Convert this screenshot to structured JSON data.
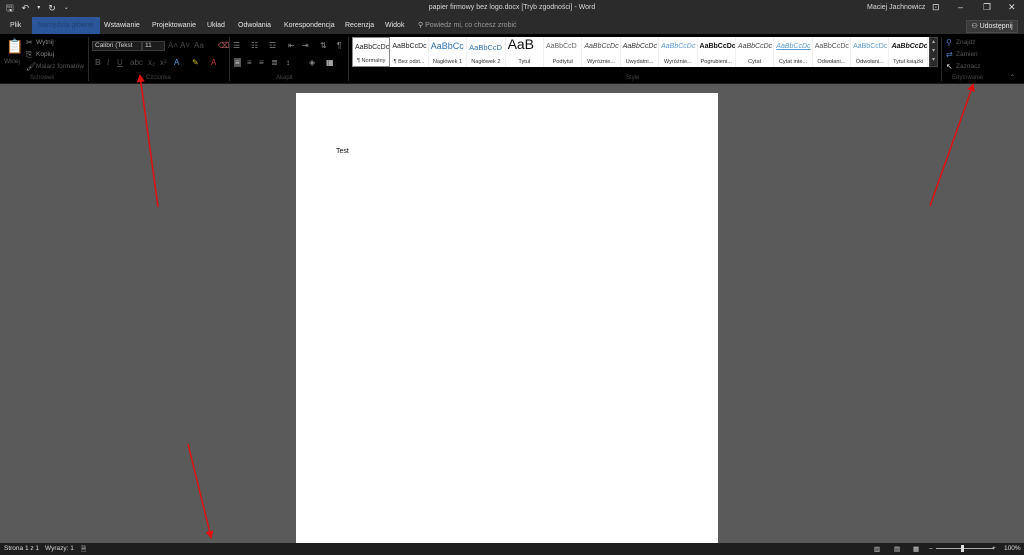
{
  "titlebar": {
    "doc_title": "papier firmowy bez logo.docx [Tryb zgodności] - Word",
    "user": "Maciej Jachnowicz"
  },
  "tabs": [
    {
      "label": "Plik"
    },
    {
      "label": "Narzędzia główne"
    },
    {
      "label": "Wstawianie"
    },
    {
      "label": "Projektowanie"
    },
    {
      "label": "Układ"
    },
    {
      "label": "Odwołania"
    },
    {
      "label": "Korespondencja"
    },
    {
      "label": "Recenzja"
    },
    {
      "label": "Widok"
    }
  ],
  "tell_me": "Powiedz mi, co chcesz zrobić",
  "share": "Udostępnij",
  "clipboard": {
    "paste": "Wklej",
    "cut": "Wytnij",
    "copy": "Kopiuj",
    "format_painter": "Malarz formatów",
    "group": "Schowek"
  },
  "font": {
    "name": "Calibri (Tekst",
    "size": "11",
    "group": "Czcionka"
  },
  "paragraph": {
    "group": "Akapit"
  },
  "styles": {
    "group": "Style",
    "items": [
      {
        "preview": "AaBbCcDc",
        "name": "¶ Normalny"
      },
      {
        "preview": "AaBbCcDc",
        "name": "¶ Bez odst..."
      },
      {
        "preview": "AaBbCc",
        "name": "Nagłówek 1"
      },
      {
        "preview": "AaBbCcD",
        "name": "Nagłówek 2"
      },
      {
        "preview": "AaB",
        "name": "Tytuł"
      },
      {
        "preview": "AaBbCcD",
        "name": "Podtytuł"
      },
      {
        "preview": "AaBbCcDc",
        "name": "Wyróżnie..."
      },
      {
        "preview": "AaBbCcDc",
        "name": "Uwydatni..."
      },
      {
        "preview": "AaBbCcDc",
        "name": "Wyróżnie..."
      },
      {
        "preview": "AaBbCcDc",
        "name": "Pogrubieni..."
      },
      {
        "preview": "AaBbCcDc",
        "name": "Cytat"
      },
      {
        "preview": "AaBbCcDc",
        "name": "Cytat inte..."
      },
      {
        "preview": "AaBbCcDc",
        "name": "Odwołani..."
      },
      {
        "preview": "AaBbCcDc",
        "name": "Odwołani..."
      },
      {
        "preview": "AaBbCcDc",
        "name": "Tytuł książki"
      }
    ]
  },
  "editing": {
    "find": "Znajdź",
    "replace": "Zamień",
    "select": "Zaznacz",
    "group": "Edytowanie"
  },
  "document": {
    "text": "Test"
  },
  "status": {
    "page": "Strona 1 z 1",
    "words": "Wyrazy: 1",
    "zoom": "100%"
  },
  "colors": {
    "accent": "#2b579a",
    "arrow": "#e01010"
  }
}
